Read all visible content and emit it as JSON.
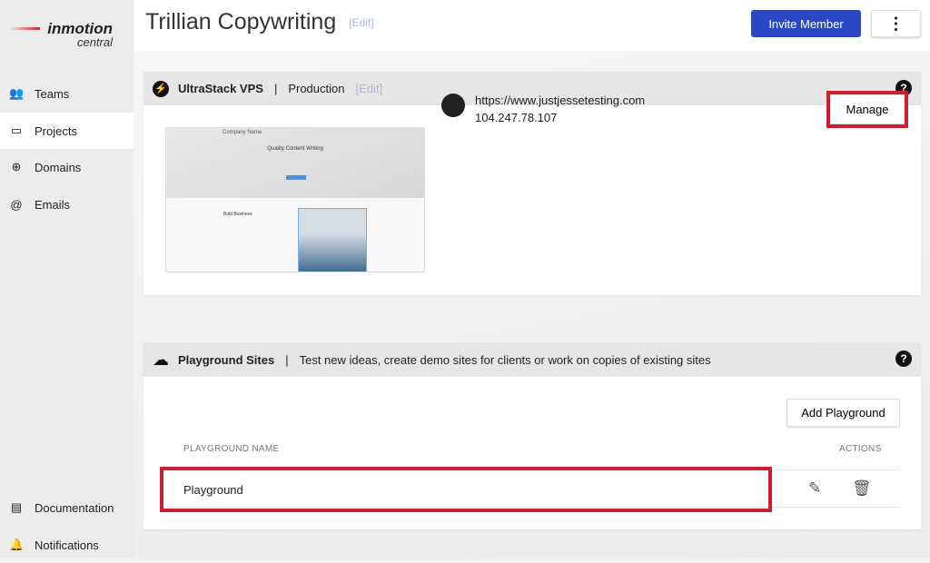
{
  "brand": {
    "line1": "inmotion",
    "line2": "central"
  },
  "sidebar": {
    "items": [
      {
        "label": "Teams",
        "icon": "users-icon"
      },
      {
        "label": "Projects",
        "icon": "window-icon",
        "active": true
      },
      {
        "label": "Domains",
        "icon": "globe-icon"
      },
      {
        "label": "Emails",
        "icon": "at-icon"
      }
    ],
    "bottom": [
      {
        "label": "Documentation",
        "icon": "document-icon"
      },
      {
        "label": "Notifications",
        "icon": "bell-icon"
      }
    ]
  },
  "header": {
    "title": "Trillian Copywriting",
    "edit": "[Edit]",
    "invite": "Invite Member",
    "more": "⋮"
  },
  "server": {
    "name": "UltraStack VPS",
    "sep": "|",
    "env": "Production",
    "edit": "[Edit]",
    "help": "?",
    "thumb": {
      "company": "Company Name",
      "headline": "Quality Content Writing",
      "section": "Bold Business"
    },
    "url": "https://www.justjessetesting.com",
    "ip": "104.247.78.107",
    "manage": "Manage"
  },
  "playground": {
    "title": "Playground Sites",
    "sep": "|",
    "description": "Test new ideas, create demo sites for clients or work on copies of existing sites",
    "help": "?",
    "add": "Add Playground",
    "columns": {
      "name": "PLAYGROUND NAME",
      "actions": "ACTIONS"
    },
    "rows": [
      {
        "name": "Playground"
      }
    ]
  },
  "colors": {
    "accent": "#2a48c6",
    "highlight": "#c8202e"
  }
}
